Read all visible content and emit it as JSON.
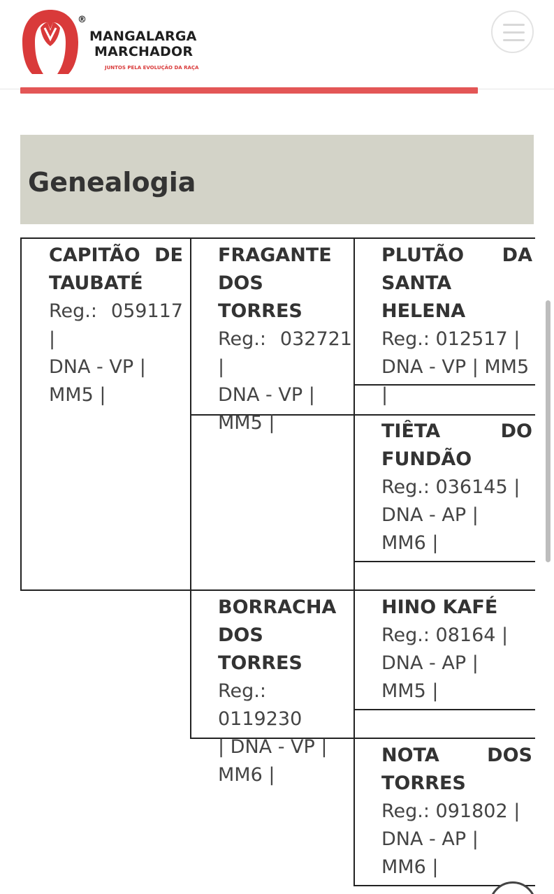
{
  "brand": {
    "line1": "MANGALARGA",
    "line2": "MARCHADOR",
    "tagline": "JUNTOS PELA EVOLUÇÃO DA RAÇA",
    "registered": "®",
    "accent_color": "#d93a3a"
  },
  "header": {
    "menu_icon": "hamburger-menu-icon"
  },
  "section": {
    "title": "Genealogia"
  },
  "pedigree": {
    "animal": {
      "name_lines": [
        "CAPITÃO DE",
        "TAUBATÉ"
      ],
      "detail_lines": [
        "Reg.: 059117 |",
        "DNA - VP |",
        "MM5 |"
      ]
    },
    "sire": {
      "name_lines": [
        "FRAGANTE",
        "DOS TORRES"
      ],
      "detail_lines": [
        "Reg.: 032721 |",
        "DNA - VP |",
        "MM5 |"
      ]
    },
    "dam": {
      "name_lines": [
        "BORRACHA",
        "DOS TORRES"
      ],
      "detail_lines": [
        "Reg.: 0119230",
        "| DNA - VP |",
        "MM6 |"
      ]
    },
    "sire_sire": {
      "name_lines": [
        "PLUTÃO DA",
        "SANTA HELENA"
      ],
      "detail_lines": [
        "Reg.: 012517 |",
        "DNA - VP | MM5",
        "|"
      ]
    },
    "sire_dam": {
      "name_lines": [
        "TIÊTA DO",
        "FUNDÃO"
      ],
      "detail_lines": [
        "Reg.: 036145 |",
        "DNA - AP |",
        "MM6 |"
      ]
    },
    "dam_sire": {
      "name_lines": [
        "HINO KAFÉ"
      ],
      "detail_lines": [
        "Reg.: 08164 |",
        "DNA - AP |",
        "MM5 |"
      ]
    },
    "dam_dam": {
      "name_lines": [
        "NOTA DOS",
        "TORRES"
      ],
      "detail_lines": [
        "Reg.: 091802 |",
        "DNA - AP |",
        "MM6 |"
      ]
    }
  }
}
